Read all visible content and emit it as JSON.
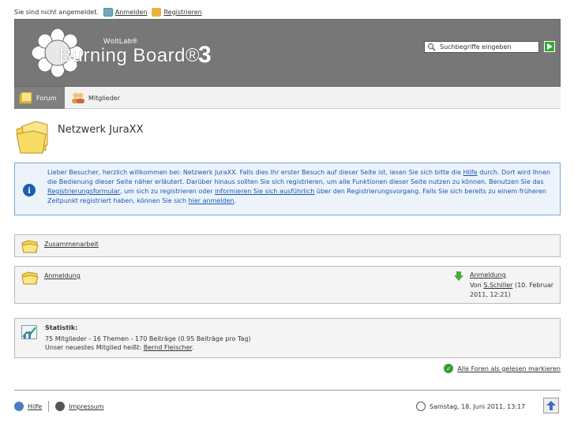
{
  "userbar": {
    "status": "Sie sind nicht angemeldet.",
    "login": "Anmelden",
    "register": "Registrieren"
  },
  "header": {
    "logo_small": "WoltLab®",
    "logo_main": "Burning Board®",
    "logo_number": "3",
    "search_placeholder": "Suchbegriffe eingeben"
  },
  "tabs": [
    {
      "label": "Forum",
      "active": true
    },
    {
      "label": "Mitglieder",
      "active": false
    }
  ],
  "page": {
    "title": "Netzwerk JuraXX"
  },
  "info": {
    "t1": "Lieber Besucher, herzlich willkommen bei: Netzwerk JuraXX. Falls dies Ihr erster Besuch auf dieser Seite ist, lesen Sie sich bitte die ",
    "l1": "Hilfe",
    "t2": " durch. Dort wird Ihnen die Bedienung dieser Seite näher erläutert. Darüber hinaus sollten Sie sich registrieren, um alle Funktionen dieser Seite nutzen zu können. Benutzen Sie das ",
    "l2": "Registrierungsformular",
    "t3": ", um sich zu registrieren oder ",
    "l3": "informieren Sie sich ausführlich",
    "t4": " über den Registrierungsvorgang. Falls Sie sich bereits zu einem früheren Zeitpunkt registriert haben, können Sie sich ",
    "l4": "hier anmelden",
    "t5": "."
  },
  "boards": [
    {
      "title": "Zusammenarbeit"
    },
    {
      "title": "Anmeldung",
      "last_post_title": "Anmeldung",
      "last_post_prefix": "Von ",
      "last_post_author": "S.Schiller",
      "last_post_date": " (10. Februar 2011, 12:21)"
    }
  ],
  "stats": {
    "title": "Statistik:",
    "line1": "75 Mitglieder - 16 Themen - 170 Beiträge (0.95 Beiträge pro Tag)",
    "line2_prefix": "Unser neuestes Mitglied heißt: ",
    "newest_member": "Bernd Fleischer",
    "line2_suffix": "."
  },
  "mark_read": "Alle Foren als gelesen markieren",
  "footer": {
    "help": "Hilfe",
    "imprint": "Impressum",
    "datetime": "Samstag, 18. Juni 2011, 13:17"
  },
  "colors": {
    "header_bg": "#777777",
    "info_text": "#1a57b0",
    "info_bg": "#ecf3fb",
    "folder": "#f5d64e"
  }
}
